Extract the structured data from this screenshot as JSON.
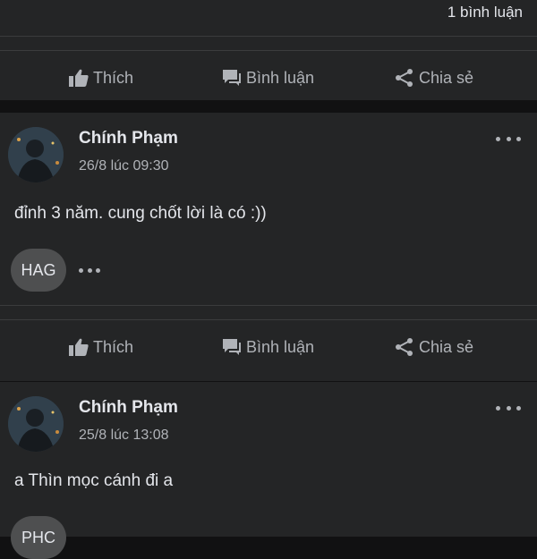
{
  "top_card": {
    "comment_count": "1 bình luận"
  },
  "actions": {
    "like": "Thích",
    "comment": "Bình luận",
    "share": "Chia sẻ"
  },
  "posts": [
    {
      "author": "Chính Phạm",
      "timestamp": "26/8 lúc 09:30",
      "text": "đỉnh 3 năm. cung chốt lời là có :))",
      "reaction_chip": "HAG"
    },
    {
      "author": "Chính Phạm",
      "timestamp": "25/8 lúc 13:08",
      "text": "a Thìn mọc cánh đi a",
      "reaction_chip": "PHC"
    }
  ]
}
